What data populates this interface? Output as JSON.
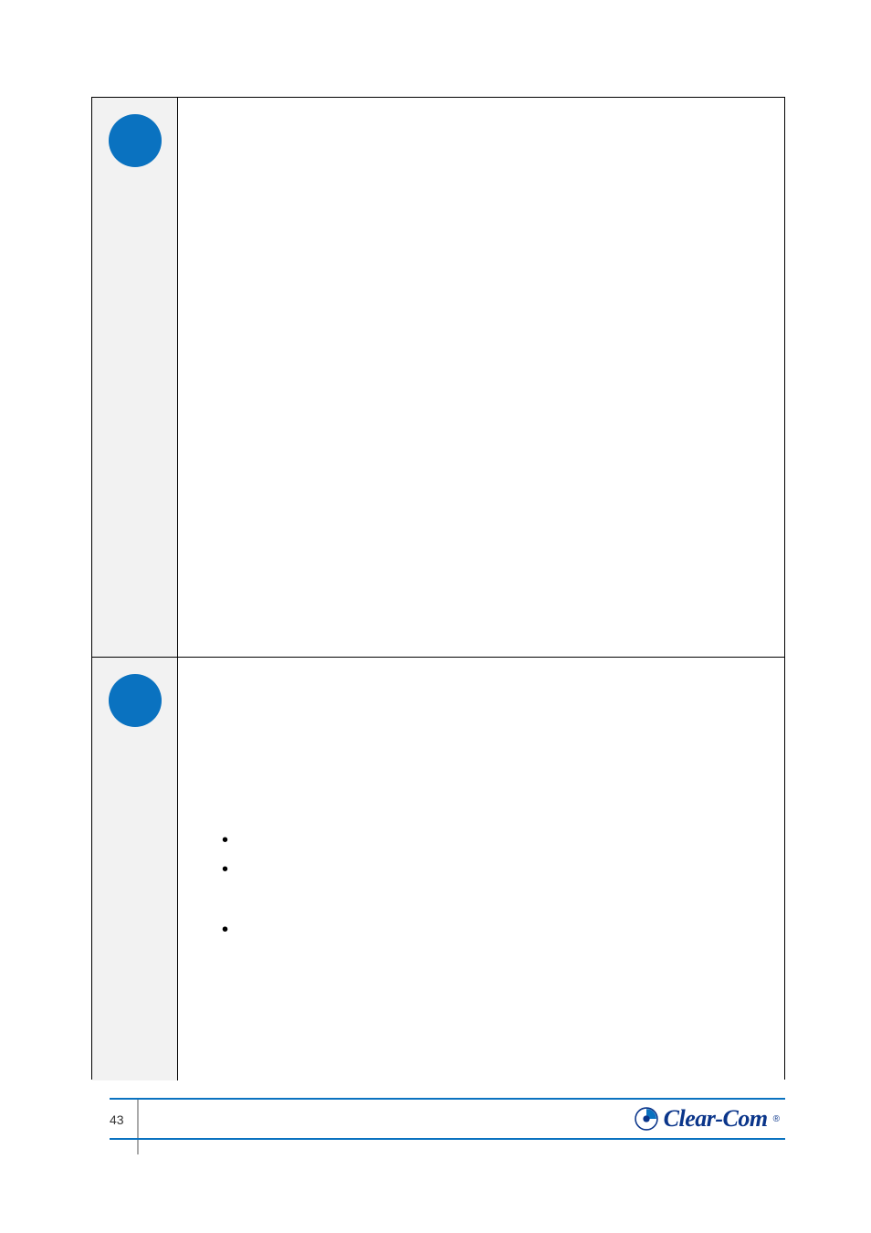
{
  "rows": [
    {
      "marker": "circle",
      "bullets": []
    },
    {
      "marker": "circle",
      "bullets": [
        "",
        "",
        "",
        ""
      ]
    }
  ],
  "footer": {
    "page_number": "43",
    "brand": "Clear-Com",
    "registered": "®"
  },
  "colors": {
    "accent": "#0a72c0",
    "brand_text": "#0a358a",
    "cell_left_bg": "#f2f2f2"
  }
}
